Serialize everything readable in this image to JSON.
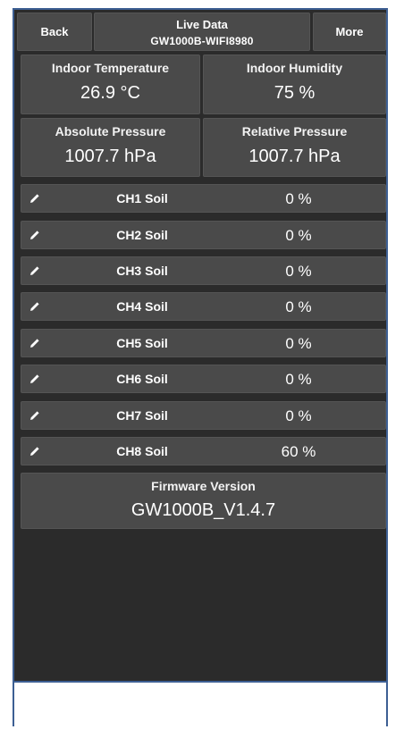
{
  "header": {
    "back_label": "Back",
    "title": "Live Data",
    "subtitle": "GW1000B-WIFI8980",
    "more_label": "More"
  },
  "indoor": {
    "temperature_label": "Indoor Temperature",
    "temperature_value": "26.9 °C",
    "humidity_label": "Indoor Humidity",
    "humidity_value": "75 %"
  },
  "pressure": {
    "absolute_label": "Absolute Pressure",
    "absolute_value": "1007.7 hPa",
    "relative_label": "Relative Pressure",
    "relative_value": "1007.7 hPa"
  },
  "soil": [
    {
      "name": "CH1 Soil",
      "value": "0 %",
      "icon": "pencil-icon"
    },
    {
      "name": "CH2 Soil",
      "value": "0 %",
      "icon": "pencil-icon"
    },
    {
      "name": "CH3 Soil",
      "value": "0 %",
      "icon": "pencil-icon"
    },
    {
      "name": "CH4 Soil",
      "value": "0 %",
      "icon": "pencil-icon"
    },
    {
      "name": "CH5 Soil",
      "value": "0 %",
      "icon": "pencil-icon"
    },
    {
      "name": "CH6 Soil",
      "value": "0 %",
      "icon": "pencil-icon"
    },
    {
      "name": "CH7 Soil",
      "value": "0 %",
      "icon": "pencil-icon"
    },
    {
      "name": "CH8 Soil",
      "value": "60 %",
      "icon": "pencil-icon"
    }
  ],
  "firmware": {
    "label": "Firmware Version",
    "value": "GW1000B_V1.4.7"
  },
  "colors": {
    "background": "#2b2b2b",
    "tile": "#4a4a4a",
    "frame": "#3d5f93",
    "text": "#ffffff"
  }
}
